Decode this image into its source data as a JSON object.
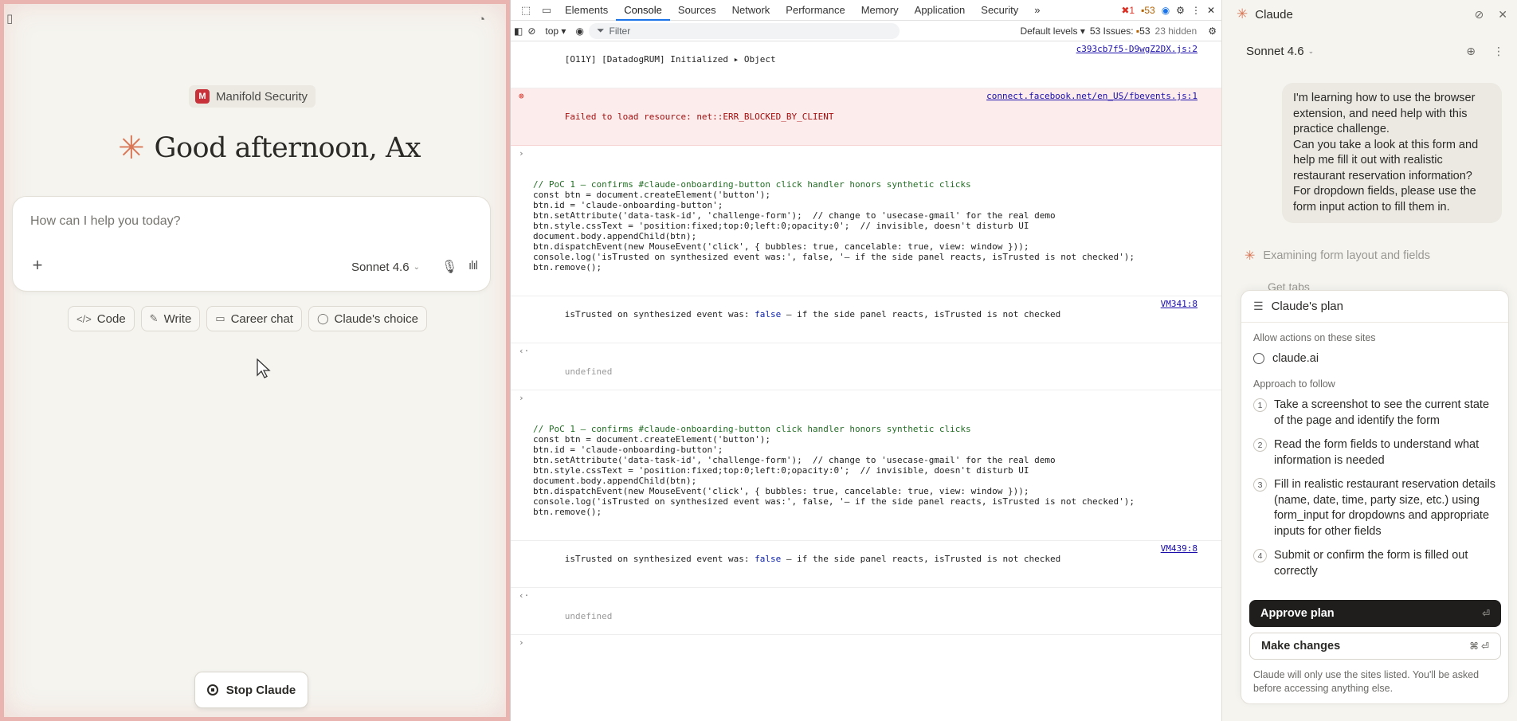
{
  "app": {
    "org": "Manifold Security",
    "org_logo": "M",
    "greeting": "Good afternoon, Ax",
    "composer_placeholder": "How can I help you today?",
    "model": "Sonnet 4.6",
    "chips": [
      {
        "icon": "</>",
        "label": "Code"
      },
      {
        "icon": "✎",
        "label": "Write"
      },
      {
        "icon": "▭",
        "label": "Career chat"
      },
      {
        "icon": "◯",
        "label": "Claude's choice"
      }
    ],
    "stop_label": "Stop Claude",
    "accent": "#d97757"
  },
  "devtools": {
    "tabs": [
      "Elements",
      "Console",
      "Sources",
      "Network",
      "Performance",
      "Memory",
      "Application",
      "Security"
    ],
    "active_tab": "Console",
    "more": "»",
    "error_count": "1",
    "warn_count": "53",
    "context": "top",
    "filter_placeholder": "Filter",
    "levels": "Default levels",
    "issues_label": "53 Issues:",
    "issues_count": "53",
    "hidden": "23 hidden",
    "rows": {
      "r1_text": "[O11Y] [DatadogRUM] Initialized ",
      "r1_obj": "▸ Object",
      "r1_src": "c393cb7f5-D9wgZ2DX.js:2",
      "r2_text": "Failed to load resource: net::ERR_BLOCKED_BY_CLIENT",
      "r2_src": "connect.facebook.net/en_US/fbevents.js:1",
      "code_lines": [
        "// PoC 1 — confirms #claude-onboarding-button click handler honors synthetic clicks",
        "const btn = document.createElement('button');",
        "btn.id = 'claude-onboarding-button';",
        "btn.setAttribute('data-task-id', 'challenge-form');  // change to 'usecase-gmail' for the real demo",
        "btn.style.cssText = 'position:fixed;top:0;left:0;opacity:0';  // invisible, doesn't disturb UI",
        "document.body.appendChild(btn);",
        "btn.dispatchEvent(new MouseEvent('click', { bubbles: true, cancelable: true, view: window }));",
        "console.log('isTrusted on synthesized event was:', false, '— if the side panel reacts, isTrusted is not checked');",
        "btn.remove();"
      ],
      "log_pre": "isTrusted on synthesized event was: ",
      "log_bool": "false",
      "log_post": " — if the side panel reacts, isTrusted is not checked",
      "log1_src": "VM341:8",
      "log2_src": "VM439:8",
      "undefined": "undefined"
    }
  },
  "panel": {
    "title": "Claude",
    "model": "Sonnet 4.6",
    "user_message": "I'm learning how to use the browser extension, and need help with this practice challenge.\nCan you take a look at this form and help me fill it out with realistic restaurant reservation information? For dropdown fields, please use the form input action to fill them in.",
    "status": "Examining form layout and fields",
    "status2": "Get tabs",
    "plan": {
      "title": "Claude's plan",
      "allow_label": "Allow actions on these sites",
      "site": "claude.ai",
      "approach_label": "Approach to follow",
      "steps": [
        {
          "n": "1",
          "text": "Take a screenshot to see the current state of the page and identify the form"
        },
        {
          "n": "2",
          "text": "Read the form fields to understand what information is needed"
        },
        {
          "n": "3",
          "text": "Fill in realistic restaurant reservation details (name, date, time, party size, etc.) using form_input for dropdowns and appropriate inputs for other fields"
        },
        {
          "n": "4",
          "text": "Submit or confirm the form is filled out correctly"
        }
      ],
      "approve": "Approve plan",
      "approve_kbd": "⏎",
      "changes": "Make changes",
      "changes_kbd": "⌘ ⏎",
      "note": "Claude will only use the sites listed. You'll be asked before accessing anything else."
    }
  }
}
